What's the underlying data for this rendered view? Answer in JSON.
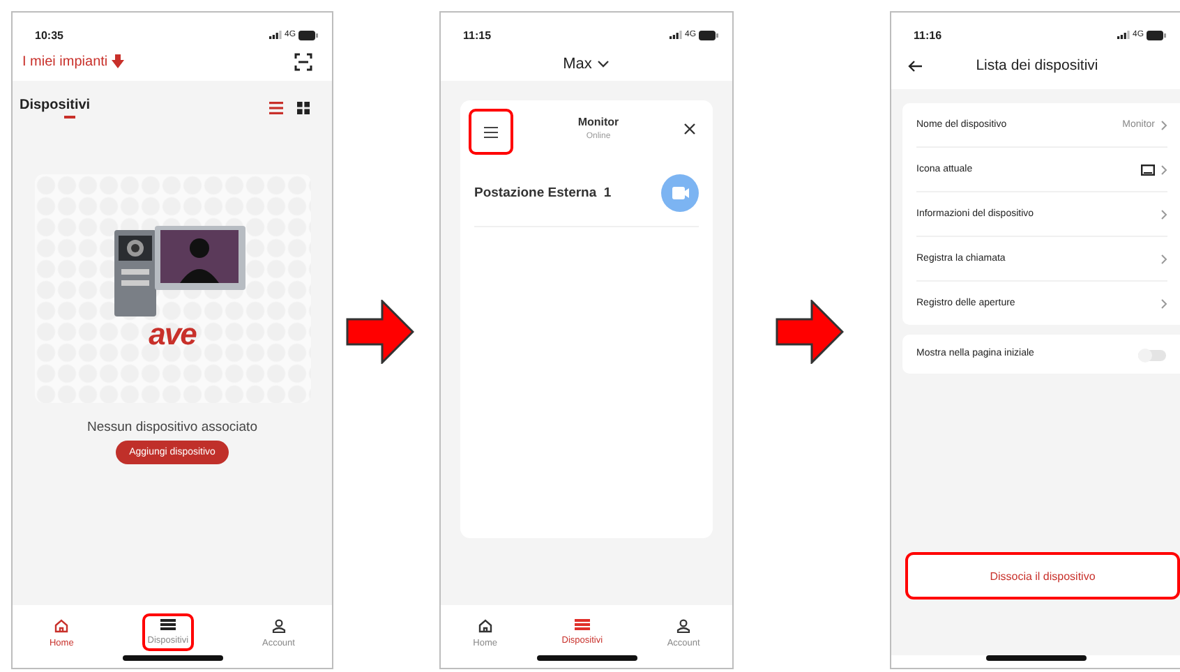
{
  "screens": [
    {
      "kind": "empty_devices",
      "time": "10:35",
      "network": "4G",
      "plant_title": "I miei impianti",
      "section_title": "Dispositivi",
      "view_modes": [
        {
          "kind": "list",
          "selected": true
        },
        {
          "kind": "grid",
          "selected": false
        }
      ],
      "logo_text": "ave",
      "empty_message": "Nessun dispositivo associato",
      "add_button": "Aggiungi dispositivo",
      "tabs": [
        {
          "kind": "home",
          "label": "Home",
          "selected": true,
          "highlighted": false
        },
        {
          "kind": "devices",
          "label": "Dispositivi",
          "selected": false,
          "highlighted": true
        },
        {
          "kind": "account",
          "label": "Account",
          "selected": false,
          "highlighted": false
        }
      ]
    },
    {
      "kind": "device_card",
      "time": "11:15",
      "network": "4G",
      "user": "Max",
      "menu_highlighted": true,
      "device_name": "Monitor",
      "device_status": "Online",
      "station": "Postazione Esterna  1",
      "tabs": [
        {
          "kind": "home",
          "label": "Home",
          "selected": false,
          "highlighted": false
        },
        {
          "kind": "devices",
          "label": "Dispositivi",
          "selected": true,
          "highlighted": false
        },
        {
          "kind": "account",
          "label": "Account",
          "selected": false,
          "highlighted": false
        }
      ]
    },
    {
      "kind": "device_settings",
      "time": "11:16",
      "network": "4G",
      "title": "Lista dei dispositivi",
      "rows": [
        {
          "kind": "value",
          "label": "Nome del dispositivo",
          "value": "Monitor"
        },
        {
          "kind": "icon",
          "label": "Icona attuale"
        },
        {
          "kind": "plain",
          "label": "Informazioni del dispositivo"
        },
        {
          "kind": "plain",
          "label": "Registra la chiamata"
        },
        {
          "kind": "plain",
          "label": "Registro delle aperture"
        }
      ],
      "toggle": {
        "label": "Mostra nella pagina iniziale",
        "on": false
      },
      "unlink_button": {
        "label": "Dissocia il dispositivo",
        "highlighted": true
      }
    }
  ]
}
